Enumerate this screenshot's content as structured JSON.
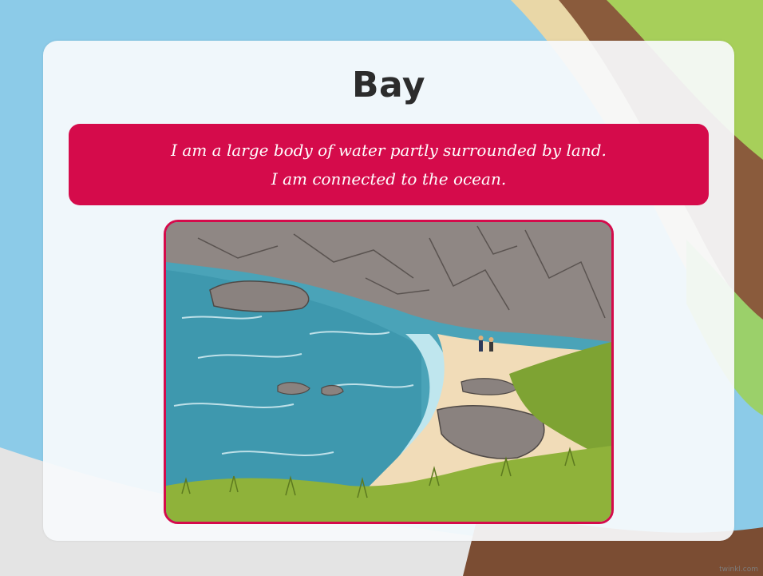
{
  "slide": {
    "title": "Bay",
    "description_lines": [
      "I am a large body of water partly surrounded by land.",
      "I am connected to the ocean."
    ],
    "watermark": "twinkl.com"
  },
  "colors": {
    "banner": "#d50b4b",
    "frame_border": "#d50b4b",
    "sea": "#4aa3b8",
    "sand": "#f1dcb8",
    "grass": "#8fb23a",
    "rock": "#8f8784"
  }
}
